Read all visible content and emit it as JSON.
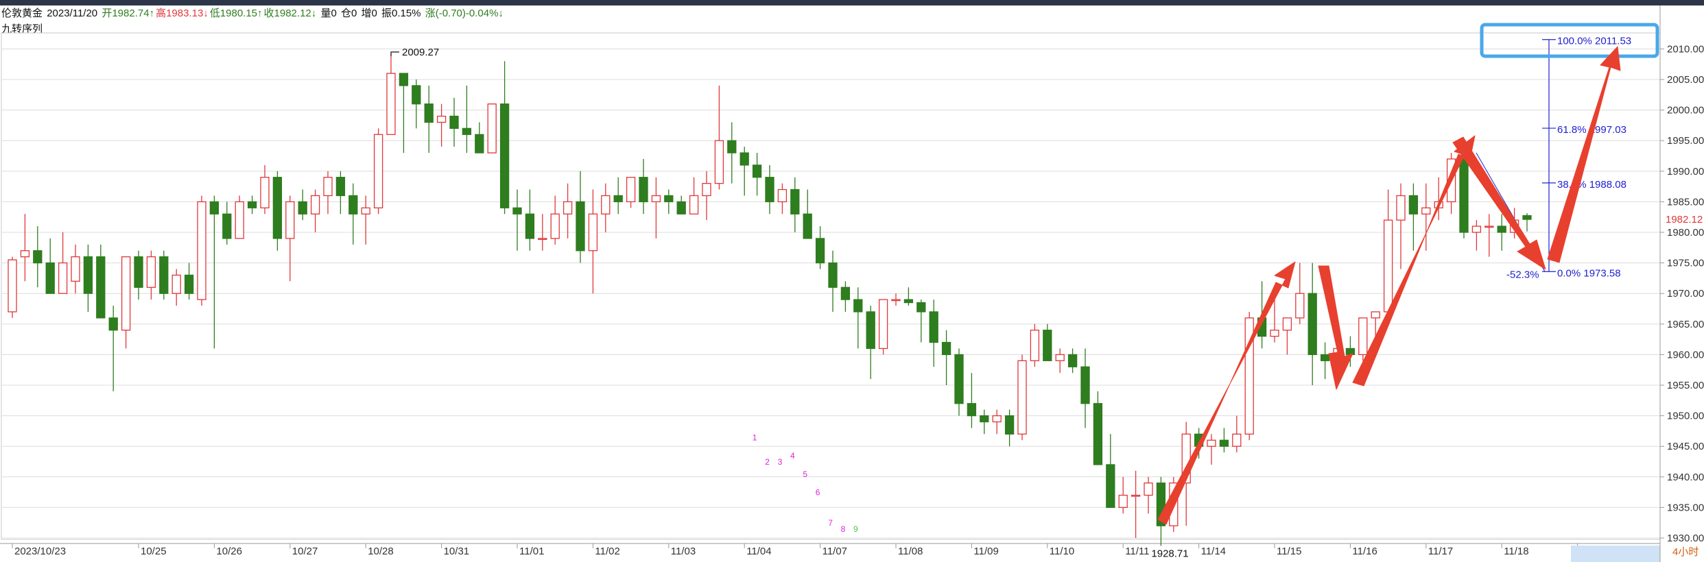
{
  "header": {
    "name": "伦敦黄金",
    "date": "2023/11/20",
    "open": "开1982.74↑",
    "high": "高1983.13↓",
    "low": "低1980.15↑",
    "close": "收1982.12↓",
    "volume": "量0",
    "position": "仓0",
    "change_pos": "增0",
    "amplitude": "振0.15%",
    "change": "涨(-0.70)-0.04%↓"
  },
  "indicator_label": "九转序列",
  "period_label": "4小时",
  "colors": {
    "up": "#e0373a",
    "down": "#2e7d1f",
    "fib": "#2020d0",
    "arrow": "#e8402e",
    "highlight": "#4aa8e8",
    "td": "#e020e0"
  },
  "chart_data": {
    "type": "candlestick",
    "ylim": [
      1930,
      2011.5
    ],
    "yticks": [
      1930,
      1935,
      1940,
      1945,
      1950,
      1955,
      1960,
      1965,
      1970,
      1975,
      1980,
      1985,
      1990,
      1995,
      2000,
      2005,
      2010
    ],
    "ytick_labels": [
      "1930.00",
      "1935.00",
      "1940.00",
      "1945.00",
      "1950.00",
      "1955.00",
      "1960.00",
      "1965.00",
      "1970.00",
      "1975.00",
      "1980.00",
      "1985.00",
      "1990.00",
      "1995.00",
      "2000.00",
      "2005.00",
      "2010.00"
    ],
    "xticks": [
      {
        "i": 0,
        "label": "2023/10/23"
      },
      {
        "i": 10,
        "label": "10/25"
      },
      {
        "i": 16,
        "label": "10/26"
      },
      {
        "i": 22,
        "label": "10/27"
      },
      {
        "i": 28,
        "label": "10/28"
      },
      {
        "i": 34,
        "label": "10/31"
      },
      {
        "i": 40,
        "label": "11/01"
      },
      {
        "i": 46,
        "label": "11/02"
      },
      {
        "i": 52,
        "label": "11/03"
      },
      {
        "i": 58,
        "label": "11/04"
      },
      {
        "i": 64,
        "label": "11/07"
      },
      {
        "i": 70,
        "label": "11/08"
      },
      {
        "i": 76,
        "label": "11/09"
      },
      {
        "i": 82,
        "label": "11/10"
      },
      {
        "i": 88,
        "label": "11/11"
      },
      {
        "i": 94,
        "label": "11/14"
      },
      {
        "i": 100,
        "label": "11/15"
      },
      {
        "i": 106,
        "label": "11/16"
      },
      {
        "i": 112,
        "label": "11/17"
      },
      {
        "i": 118,
        "label": "11/18"
      },
      {
        "i": 124,
        "label": "11/21"
      }
    ],
    "last_price": "1982.12",
    "ohlc": [
      [
        1967,
        1976,
        1966,
        1975.5
      ],
      [
        1976,
        1983,
        1972,
        1977
      ],
      [
        1977,
        1981,
        1971,
        1975
      ],
      [
        1975,
        1979,
        1970,
        1970
      ],
      [
        1970,
        1980,
        1970,
        1975
      ],
      [
        1972,
        1978,
        1970,
        1976
      ],
      [
        1976,
        1978,
        1967,
        1970
      ],
      [
        1976,
        1978,
        1966,
        1966
      ],
      [
        1966,
        1968,
        1954,
        1964
      ],
      [
        1964,
        1973,
        1961,
        1976
      ],
      [
        1976,
        1977,
        1969,
        1971
      ],
      [
        1971,
        1977,
        1969,
        1976
      ],
      [
        1976,
        1977,
        1969,
        1970
      ],
      [
        1970,
        1974,
        1968,
        1973
      ],
      [
        1973,
        1975,
        1969,
        1970
      ],
      [
        1969,
        1986,
        1968,
        1985
      ],
      [
        1985,
        1986,
        1961,
        1983
      ],
      [
        1983,
        1985,
        1978,
        1979
      ],
      [
        1979,
        1986,
        1979,
        1985
      ],
      [
        1985,
        1986,
        1983,
        1984
      ],
      [
        1984,
        1991,
        1983,
        1989
      ],
      [
        1989,
        1990,
        1977,
        1979
      ],
      [
        1979,
        1986,
        1972,
        1985
      ],
      [
        1985,
        1987,
        1982,
        1983
      ],
      [
        1983,
        1987,
        1980,
        1986
      ],
      [
        1986,
        1990,
        1983,
        1989
      ],
      [
        1989,
        1990,
        1983,
        1986
      ],
      [
        1986,
        1988,
        1978,
        1983
      ],
      [
        1983,
        1986,
        1978,
        1984
      ],
      [
        1984,
        1997,
        1983,
        1996
      ],
      [
        1996,
        2009.27,
        1996,
        2006
      ],
      [
        2006,
        2006,
        1993,
        2004
      ],
      [
        2004,
        2005,
        1997,
        2001
      ],
      [
        2001,
        2004,
        1993,
        1998
      ],
      [
        1998,
        2001,
        1994,
        1999
      ],
      [
        1999,
        2002,
        1994,
        1997
      ],
      [
        1997,
        2004,
        1993,
        1996
      ],
      [
        1996,
        1998,
        1993,
        1993
      ],
      [
        1993,
        2000,
        1993,
        2001
      ],
      [
        2001,
        2008,
        1983,
        1984
      ],
      [
        1984,
        1987,
        1977,
        1983
      ],
      [
        1983,
        1987,
        1977,
        1979
      ],
      [
        1979,
        1983,
        1977,
        1979
      ],
      [
        1979,
        1986,
        1978,
        1983
      ],
      [
        1983,
        1988,
        1979,
        1985
      ],
      [
        1985,
        1990,
        1975,
        1977
      ],
      [
        1977,
        1987,
        1970,
        1983
      ],
      [
        1983,
        1988,
        1980,
        1986
      ],
      [
        1986,
        1989,
        1983,
        1985
      ],
      [
        1985,
        1988,
        1984,
        1989
      ],
      [
        1989,
        1992,
        1983,
        1985
      ],
      [
        1985,
        1989,
        1979,
        1986
      ],
      [
        1986,
        1987,
        1983,
        1985
      ],
      [
        1985,
        1986,
        1983,
        1983
      ],
      [
        1983,
        1989,
        1983,
        1986
      ],
      [
        1986,
        1990,
        1982,
        1988
      ],
      [
        1988,
        2004,
        1987,
        1995
      ],
      [
        1995,
        1998,
        1988,
        1993
      ],
      [
        1993,
        1994,
        1986,
        1991
      ],
      [
        1991,
        1993,
        1986,
        1989
      ],
      [
        1989,
        1991,
        1983,
        1985
      ],
      [
        1985,
        1988,
        1983,
        1987
      ],
      [
        1987,
        1989,
        1980,
        1983
      ],
      [
        1983,
        1987,
        1979,
        1979
      ],
      [
        1979,
        1981,
        1974,
        1975
      ],
      [
        1975,
        1977,
        1967,
        1971
      ],
      [
        1971,
        1972,
        1967,
        1969
      ],
      [
        1969,
        1971,
        1961,
        1967
      ],
      [
        1967,
        1968,
        1956,
        1961
      ],
      [
        1961,
        1969,
        1960,
        1969
      ],
      [
        1969,
        1970,
        1968,
        1969
      ],
      [
        1969,
        1971,
        1968,
        1968.5
      ],
      [
        1968.5,
        1969,
        1962,
        1967
      ],
      [
        1967,
        1969,
        1958,
        1962
      ],
      [
        1962,
        1964,
        1955,
        1960
      ],
      [
        1960,
        1961,
        1950,
        1952
      ],
      [
        1952,
        1957,
        1948,
        1950
      ],
      [
        1950,
        1951,
        1947,
        1949
      ],
      [
        1949,
        1951,
        1947,
        1950
      ],
      [
        1950,
        1951,
        1945,
        1947
      ],
      [
        1947,
        1960,
        1946,
        1959
      ],
      [
        1959,
        1965,
        1958,
        1964
      ],
      [
        1964,
        1965,
        1959,
        1959
      ],
      [
        1959,
        1961,
        1957,
        1960
      ],
      [
        1960,
        1961,
        1957,
        1958
      ],
      [
        1958,
        1961,
        1948,
        1952
      ],
      [
        1952,
        1954,
        1942,
        1942
      ],
      [
        1942,
        1947,
        1935,
        1935
      ],
      [
        1935,
        1940,
        1934,
        1937
      ],
      [
        1937,
        1941,
        1930,
        1937
      ],
      [
        1937,
        1940,
        1934,
        1939
      ],
      [
        1939,
        1940,
        1928.71,
        1932
      ],
      [
        1932,
        1940,
        1931,
        1939
      ],
      [
        1939,
        1949,
        1932,
        1947
      ],
      [
        1947,
        1948,
        1943,
        1945
      ],
      [
        1945,
        1947,
        1942,
        1946
      ],
      [
        1946,
        1948,
        1944,
        1945
      ],
      [
        1945,
        1950,
        1944,
        1947
      ],
      [
        1947,
        1967,
        1946,
        1966
      ],
      [
        1966,
        1972,
        1961,
        1963
      ],
      [
        1963,
        1971,
        1962,
        1964
      ],
      [
        1964,
        1966,
        1960,
        1966
      ],
      [
        1966,
        1975,
        1965,
        1970
      ],
      [
        1970,
        1975,
        1955,
        1960
      ],
      [
        1960,
        1962,
        1956,
        1959
      ],
      [
        1959,
        1962,
        1958,
        1961
      ],
      [
        1961,
        1963,
        1958,
        1960
      ],
      [
        1960,
        1966,
        1959,
        1966
      ],
      [
        1966,
        1967,
        1962,
        1967
      ],
      [
        1967,
        1987,
        1966,
        1982
      ],
      [
        1982,
        1988,
        1974,
        1986
      ],
      [
        1986,
        1988,
        1977,
        1983
      ],
      [
        1983,
        1988,
        1977,
        1984
      ],
      [
        1984,
        1989,
        1982,
        1985
      ],
      [
        1985,
        1993,
        1983,
        1992
      ],
      [
        1992,
        1993,
        1979,
        1980
      ],
      [
        1980,
        1982,
        1977,
        1981
      ],
      [
        1981,
        1983,
        1976,
        1981
      ],
      [
        1981,
        1983,
        1977,
        1980
      ],
      [
        1980,
        1984,
        1979,
        1982
      ],
      [
        1982.74,
        1983.13,
        1980.15,
        1982.12
      ]
    ],
    "annotations": [
      {
        "text": "2009.27",
        "i": 30,
        "price": 2009.27,
        "pos": "top"
      },
      {
        "text": "1928.71",
        "i": 91,
        "price": 1928.71,
        "pos": "bottom"
      }
    ],
    "fibonacci": {
      "levels": [
        {
          "label": "100.0% 2011.53",
          "price": 2011.53
        },
        {
          "label": "61.8% 1997.03",
          "price": 1997.03
        },
        {
          "label": "38.2% 1988.08",
          "price": 1988.08
        },
        {
          "label": "0.0% 1973.58",
          "price": 1973.58
        }
      ],
      "extra_label": "-52.3%"
    },
    "td_sequence": [
      {
        "n": "1",
        "i": 57,
        "price": 1946
      },
      {
        "n": "2",
        "i": 58,
        "price": 1942
      },
      {
        "n": "3",
        "i": 59,
        "price": 1942
      },
      {
        "n": "4",
        "i": 60,
        "price": 1943
      },
      {
        "n": "5",
        "i": 61,
        "price": 1940
      },
      {
        "n": "6",
        "i": 62,
        "price": 1937
      },
      {
        "n": "7",
        "i": 63,
        "price": 1932
      },
      {
        "n": "8",
        "i": 64,
        "price": 1931
      },
      {
        "n": "9",
        "i": 65,
        "price": 1931
      }
    ]
  }
}
